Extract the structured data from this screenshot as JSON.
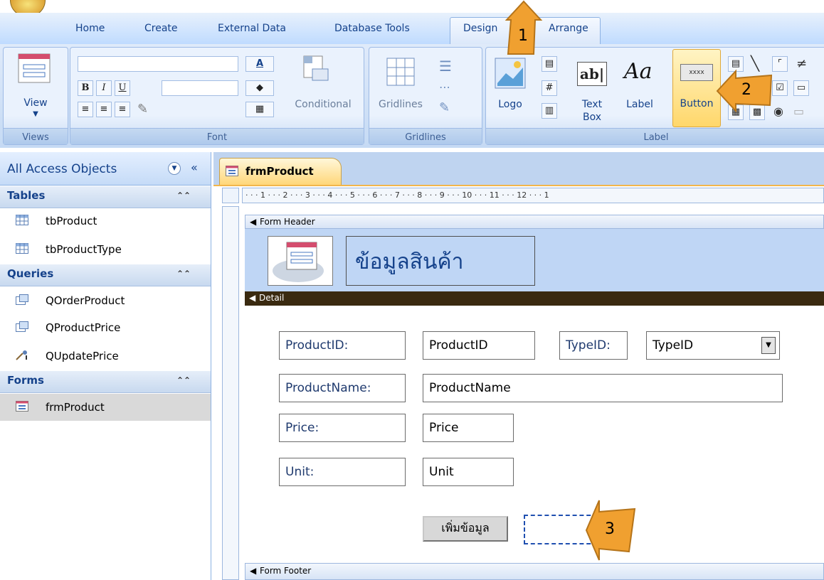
{
  "ribbon": {
    "tabs": [
      "Home",
      "Create",
      "External Data",
      "Database Tools",
      "Design",
      "Arrange"
    ],
    "active_tab": "Design",
    "groups": {
      "views": {
        "label": "Views",
        "view_button": "View"
      },
      "font": {
        "label": "Font",
        "conditional": "Conditional"
      },
      "gridlines": {
        "label": "Gridlines",
        "gridlines_button": "Gridlines"
      },
      "controls": {
        "label": "Label",
        "logo": "Logo",
        "text_box_line1": "Text",
        "text_box_line2": "Box",
        "button": "Button",
        "button_preview": "xxxx"
      }
    }
  },
  "nav": {
    "title": "All Access Objects",
    "categories": [
      {
        "name": "Tables",
        "items": [
          "tbProduct",
          "tbProductType"
        ]
      },
      {
        "name": "Queries",
        "items": [
          "QOrderProduct",
          "QProductPrice",
          "QUpdatePrice"
        ]
      },
      {
        "name": "Forms",
        "items": [
          "frmProduct"
        ]
      }
    ]
  },
  "document": {
    "tab_title": "frmProduct",
    "ruler": "· · · 1 · · · 2 · · · 3 · · · 4 · · · 5 · · · 6 · · · 7 · · · 8 · · · 9 · · · 10 · · · 11 · · · 12 · · · 1",
    "sections": {
      "header": "Form Header",
      "detail": "Detail",
      "footer": "Form Footer"
    },
    "header_title": "ข้อมูลสินค้า",
    "fields": {
      "product_id_label": "ProductID:",
      "product_id_box": "ProductID",
      "type_id_label": "TypeID:",
      "type_id_box": "TypeID",
      "product_name_label": "ProductName:",
      "product_name_box": "ProductName",
      "price_label": "Price:",
      "price_box": "Price",
      "unit_label": "Unit:",
      "unit_box": "Unit"
    },
    "add_button": "เพิ่มข้อมูล"
  },
  "callouts": [
    "1",
    "2",
    "3"
  ],
  "colors": {
    "callout": "#f0a030",
    "detail_bar": "#3a2a10",
    "selected_button": "#ffd76b"
  }
}
